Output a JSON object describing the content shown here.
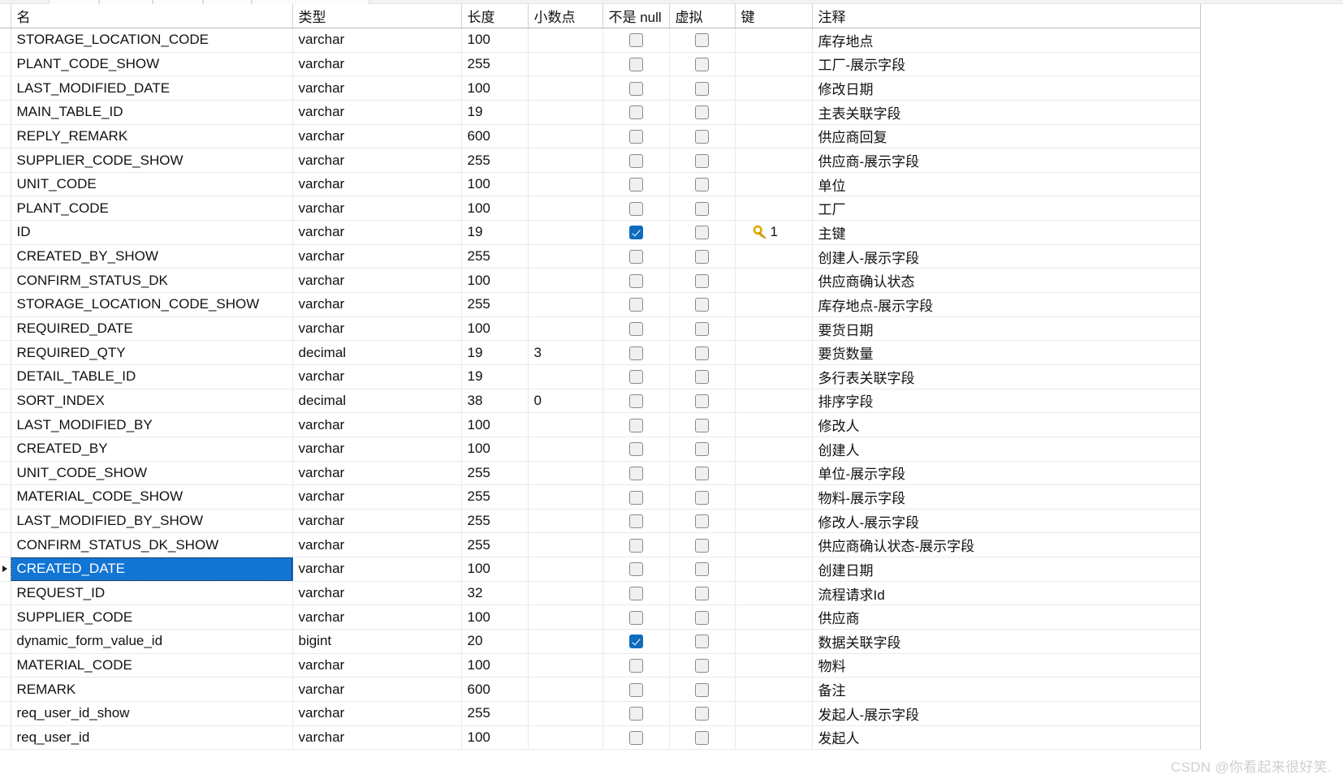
{
  "window": {
    "watermark": "CSDN @你看起来很好笑."
  },
  "grid": {
    "columns": [
      {
        "key": "name",
        "label": "名"
      },
      {
        "key": "type",
        "label": "类型"
      },
      {
        "key": "length",
        "label": "长度"
      },
      {
        "key": "decimal",
        "label": "小数点"
      },
      {
        "key": "notnull",
        "label": "不是 null"
      },
      {
        "key": "virtual",
        "label": "虚拟"
      },
      {
        "key": "key",
        "label": "键"
      },
      {
        "key": "comment",
        "label": "注释"
      }
    ],
    "selected_row_index": 22,
    "colors": {
      "selection": "#1275d4",
      "checkbox_checked": "#0f6cbd",
      "key_icon": "#e0a800",
      "grid_line": "#eaeaea",
      "header_line": "#b9b9b9"
    },
    "rows": [
      {
        "name": "STORAGE_LOCATION_CODE",
        "type": "varchar",
        "length": "100",
        "decimal": "",
        "notnull": false,
        "virtual": false,
        "key": "",
        "comment": "库存地点"
      },
      {
        "name": "PLANT_CODE_SHOW",
        "type": "varchar",
        "length": "255",
        "decimal": "",
        "notnull": false,
        "virtual": false,
        "key": "",
        "comment": "工厂-展示字段"
      },
      {
        "name": "LAST_MODIFIED_DATE",
        "type": "varchar",
        "length": "100",
        "decimal": "",
        "notnull": false,
        "virtual": false,
        "key": "",
        "comment": "修改日期"
      },
      {
        "name": "MAIN_TABLE_ID",
        "type": "varchar",
        "length": "19",
        "decimal": "",
        "notnull": false,
        "virtual": false,
        "key": "",
        "comment": "主表关联字段"
      },
      {
        "name": "REPLY_REMARK",
        "type": "varchar",
        "length": "600",
        "decimal": "",
        "notnull": false,
        "virtual": false,
        "key": "",
        "comment": "供应商回复"
      },
      {
        "name": "SUPPLIER_CODE_SHOW",
        "type": "varchar",
        "length": "255",
        "decimal": "",
        "notnull": false,
        "virtual": false,
        "key": "",
        "comment": "供应商-展示字段"
      },
      {
        "name": "UNIT_CODE",
        "type": "varchar",
        "length": "100",
        "decimal": "",
        "notnull": false,
        "virtual": false,
        "key": "",
        "comment": "单位"
      },
      {
        "name": "PLANT_CODE",
        "type": "varchar",
        "length": "100",
        "decimal": "",
        "notnull": false,
        "virtual": false,
        "key": "",
        "comment": "工厂"
      },
      {
        "name": "ID",
        "type": "varchar",
        "length": "19",
        "decimal": "",
        "notnull": true,
        "virtual": false,
        "key": "1",
        "comment": "主键"
      },
      {
        "name": "CREATED_BY_SHOW",
        "type": "varchar",
        "length": "255",
        "decimal": "",
        "notnull": false,
        "virtual": false,
        "key": "",
        "comment": "创建人-展示字段"
      },
      {
        "name": "CONFIRM_STATUS_DK",
        "type": "varchar",
        "length": "100",
        "decimal": "",
        "notnull": false,
        "virtual": false,
        "key": "",
        "comment": "供应商确认状态"
      },
      {
        "name": "STORAGE_LOCATION_CODE_SHOW",
        "type": "varchar",
        "length": "255",
        "decimal": "",
        "notnull": false,
        "virtual": false,
        "key": "",
        "comment": "库存地点-展示字段"
      },
      {
        "name": "REQUIRED_DATE",
        "type": "varchar",
        "length": "100",
        "decimal": "",
        "notnull": false,
        "virtual": false,
        "key": "",
        "comment": "要货日期"
      },
      {
        "name": "REQUIRED_QTY",
        "type": "decimal",
        "length": "19",
        "decimal": "3",
        "notnull": false,
        "virtual": false,
        "key": "",
        "comment": "要货数量"
      },
      {
        "name": "DETAIL_TABLE_ID",
        "type": "varchar",
        "length": "19",
        "decimal": "",
        "notnull": false,
        "virtual": false,
        "key": "",
        "comment": "多行表关联字段"
      },
      {
        "name": "SORT_INDEX",
        "type": "decimal",
        "length": "38",
        "decimal": "0",
        "notnull": false,
        "virtual": false,
        "key": "",
        "comment": "排序字段"
      },
      {
        "name": "LAST_MODIFIED_BY",
        "type": "varchar",
        "length": "100",
        "decimal": "",
        "notnull": false,
        "virtual": false,
        "key": "",
        "comment": "修改人"
      },
      {
        "name": "CREATED_BY",
        "type": "varchar",
        "length": "100",
        "decimal": "",
        "notnull": false,
        "virtual": false,
        "key": "",
        "comment": "创建人"
      },
      {
        "name": "UNIT_CODE_SHOW",
        "type": "varchar",
        "length": "255",
        "decimal": "",
        "notnull": false,
        "virtual": false,
        "key": "",
        "comment": "单位-展示字段"
      },
      {
        "name": "MATERIAL_CODE_SHOW",
        "type": "varchar",
        "length": "255",
        "decimal": "",
        "notnull": false,
        "virtual": false,
        "key": "",
        "comment": "物料-展示字段"
      },
      {
        "name": "LAST_MODIFIED_BY_SHOW",
        "type": "varchar",
        "length": "255",
        "decimal": "",
        "notnull": false,
        "virtual": false,
        "key": "",
        "comment": "修改人-展示字段"
      },
      {
        "name": "CONFIRM_STATUS_DK_SHOW",
        "type": "varchar",
        "length": "255",
        "decimal": "",
        "notnull": false,
        "virtual": false,
        "key": "",
        "comment": "供应商确认状态-展示字段"
      },
      {
        "name": "CREATED_DATE",
        "type": "varchar",
        "length": "100",
        "decimal": "",
        "notnull": false,
        "virtual": false,
        "key": "",
        "comment": "创建日期"
      },
      {
        "name": "REQUEST_ID",
        "type": "varchar",
        "length": "32",
        "decimal": "",
        "notnull": false,
        "virtual": false,
        "key": "",
        "comment": "流程请求Id"
      },
      {
        "name": "SUPPLIER_CODE",
        "type": "varchar",
        "length": "100",
        "decimal": "",
        "notnull": false,
        "virtual": false,
        "key": "",
        "comment": "供应商"
      },
      {
        "name": "dynamic_form_value_id",
        "type": "bigint",
        "length": "20",
        "decimal": "",
        "notnull": true,
        "virtual": false,
        "key": "",
        "comment": "数据关联字段"
      },
      {
        "name": "MATERIAL_CODE",
        "type": "varchar",
        "length": "100",
        "decimal": "",
        "notnull": false,
        "virtual": false,
        "key": "",
        "comment": "物料"
      },
      {
        "name": "REMARK",
        "type": "varchar",
        "length": "600",
        "decimal": "",
        "notnull": false,
        "virtual": false,
        "key": "",
        "comment": "备注"
      },
      {
        "name": "req_user_id_show",
        "type": "varchar",
        "length": "255",
        "decimal": "",
        "notnull": false,
        "virtual": false,
        "key": "",
        "comment": "发起人-展示字段"
      },
      {
        "name": "req_user_id",
        "type": "varchar",
        "length": "100",
        "decimal": "",
        "notnull": false,
        "virtual": false,
        "key": "",
        "comment": "发起人"
      }
    ]
  }
}
